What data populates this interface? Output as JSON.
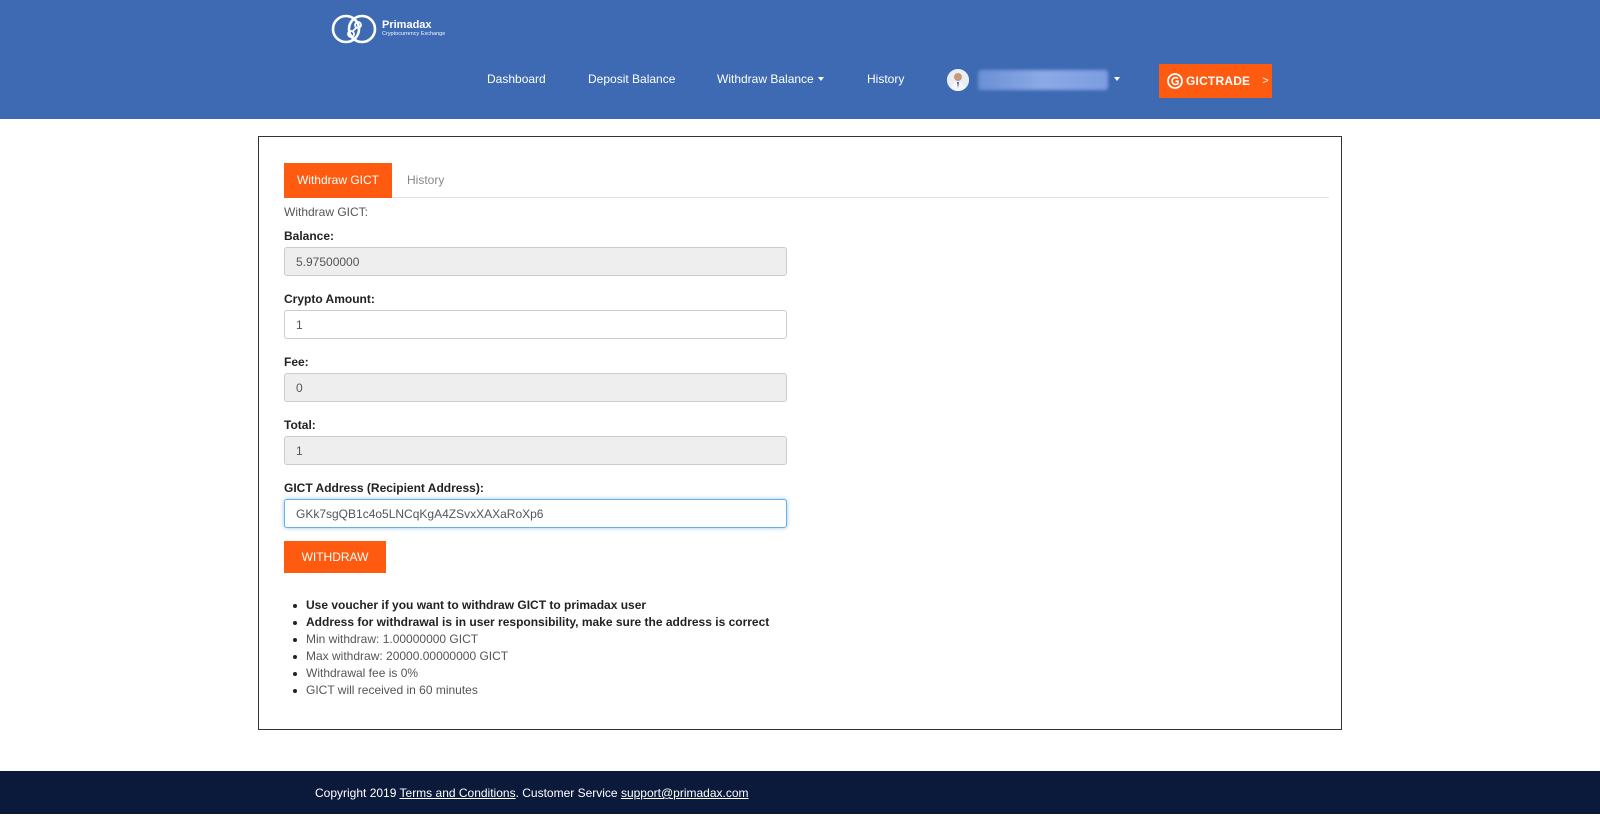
{
  "brand": {
    "name": "Primadax",
    "tagline": "Cryptocurrency Exchange",
    "logo_icon": "linked-rings-logo"
  },
  "nav": {
    "dashboard": "Dashboard",
    "deposit": "Deposit Balance",
    "withdraw": "Withdraw Balance",
    "history": "History"
  },
  "user": {
    "avatar_icon": "user-avatar",
    "name_obscured": true
  },
  "gictrade": {
    "label": "GICTRADE",
    "arrow": ">",
    "icon": "gict-coin-icon"
  },
  "tabs": {
    "active": "Withdraw GICT",
    "other": "History"
  },
  "form": {
    "title": "Withdraw GICT:",
    "balance_label": "Balance:",
    "balance_value": "5.97500000",
    "amount_label": "Crypto Amount:",
    "amount_value": "1",
    "fee_label": "Fee:",
    "fee_value": "0",
    "total_label": "Total:",
    "total_value": "1",
    "address_label": "GICT Address (Recipient Address):",
    "address_value": "GKk7sgQB1c4o5LNCqKgA4ZSvxXAXaRoXp6",
    "submit_label": "WITHDRAW"
  },
  "notes": [
    {
      "text": "Use voucher if you want to withdraw GICT to primadax user",
      "bold": true
    },
    {
      "text": "Address for withdrawal is in user responsibility, make sure the address is correct",
      "bold": true
    },
    {
      "text": "Min withdraw: 1.00000000 GICT",
      "bold": false
    },
    {
      "text": "Max withdraw: 20000.00000000 GICT",
      "bold": false
    },
    {
      "text": "Withdrawal fee is 0%",
      "bold": false
    },
    {
      "text": "GICT will received in 60 minutes",
      "bold": false
    }
  ],
  "footer": {
    "copyright": "Copyright 2019",
    "terms": "Terms and Conditions",
    "service_text": ". Customer Service",
    "email": "support@primadax.com"
  },
  "colors": {
    "header_bg": "#3d6ab3",
    "accent_orange": "#ff5b10",
    "footer_bg": "#0b1a3b"
  }
}
